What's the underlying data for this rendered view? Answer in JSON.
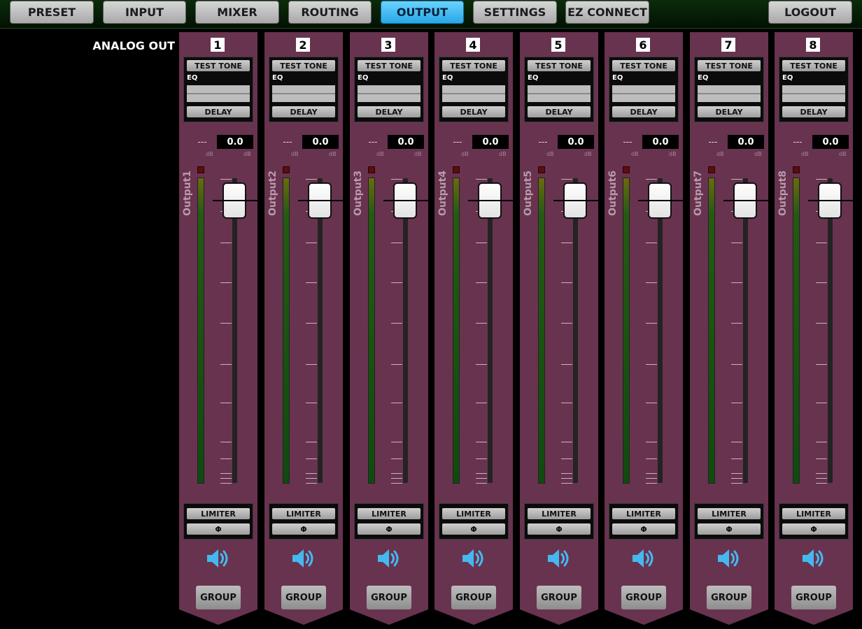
{
  "nav": {
    "tabs": [
      {
        "label": "PRESET"
      },
      {
        "label": "INPUT"
      },
      {
        "label": "MIXER"
      },
      {
        "label": "ROUTING"
      },
      {
        "label": "OUTPUT"
      },
      {
        "label": "SETTINGS"
      },
      {
        "label": "EZ CONNECT"
      }
    ],
    "active_tab": "OUTPUT",
    "logout_label": "LOGOUT"
  },
  "section": {
    "title": "ANALOG OUT"
  },
  "strip_labels": {
    "test_tone": "TEST TONE",
    "eq": "EQ",
    "delay": "DELAY",
    "limiter": "LIMITER",
    "phase": "Φ",
    "group": "GROUP",
    "db_unit": "dB"
  },
  "channels": [
    {
      "number": "1",
      "name": "Output1",
      "level_left": "---",
      "level_right": "0.0",
      "fader_level": 0.82
    },
    {
      "number": "2",
      "name": "Output2",
      "level_left": "---",
      "level_right": "0.0",
      "fader_level": 0.82
    },
    {
      "number": "3",
      "name": "Output3",
      "level_left": "---",
      "level_right": "0.0",
      "fader_level": 0.82
    },
    {
      "number": "4",
      "name": "Output4",
      "level_left": "---",
      "level_right": "0.0",
      "fader_level": 0.82
    },
    {
      "number": "5",
      "name": "Output5",
      "level_left": "---",
      "level_right": "0.0",
      "fader_level": 0.82
    },
    {
      "number": "6",
      "name": "Output6",
      "level_left": "---",
      "level_right": "0.0",
      "fader_level": 0.82
    },
    {
      "number": "7",
      "name": "Output7",
      "level_left": "---",
      "level_right": "0.0",
      "fader_level": 0.82
    },
    {
      "number": "8",
      "name": "Output8",
      "level_left": "---",
      "level_right": "0.0",
      "fader_level": 0.82
    }
  ],
  "colors": {
    "strip": "#68334f",
    "active_tab": "#3ab8f0",
    "speaker_icon": "#45b8f0"
  },
  "icons": {
    "speaker": "speaker-on-icon"
  }
}
